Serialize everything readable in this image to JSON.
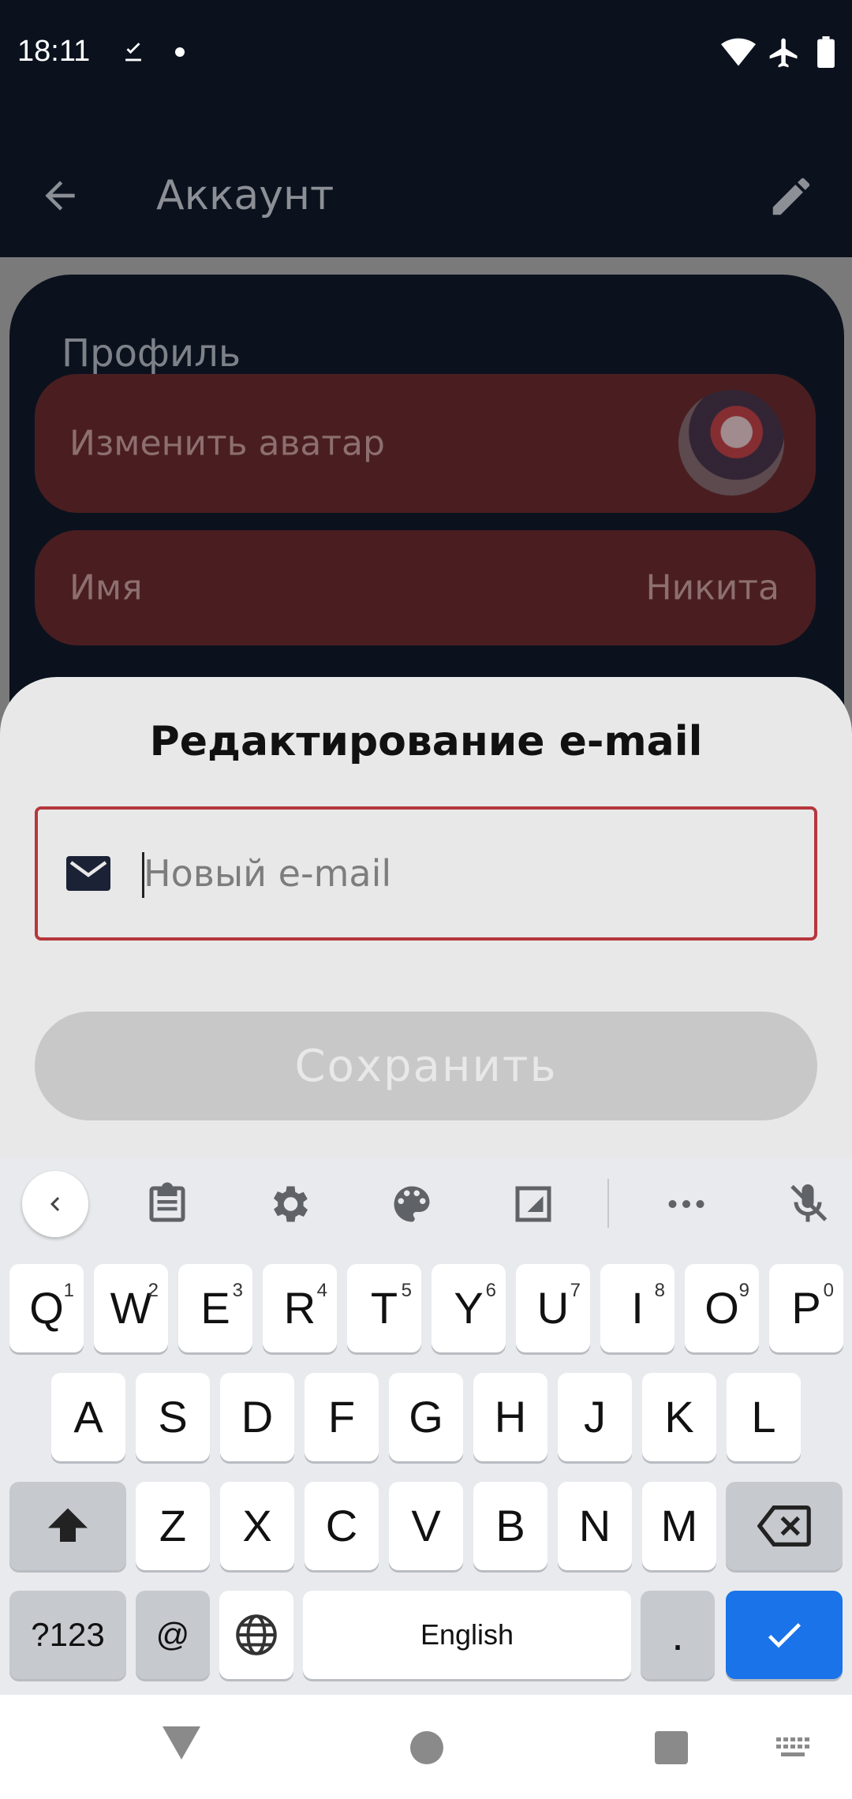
{
  "status_bar": {
    "time": "18:11"
  },
  "app_bar": {
    "title": "Аккаунт"
  },
  "profile": {
    "section_title": "Профиль",
    "change_avatar_label": "Изменить аватар",
    "name_label": "Имя",
    "name_value": "Никита"
  },
  "sheet": {
    "title": "Редактирование e-mail",
    "email_placeholder": "Новый e-mail",
    "email_value": "",
    "save_label": "Сохранить"
  },
  "keyboard": {
    "row1": [
      {
        "k": "Q",
        "h": "1"
      },
      {
        "k": "W",
        "h": "2"
      },
      {
        "k": "E",
        "h": "3"
      },
      {
        "k": "R",
        "h": "4"
      },
      {
        "k": "T",
        "h": "5"
      },
      {
        "k": "Y",
        "h": "6"
      },
      {
        "k": "U",
        "h": "7"
      },
      {
        "k": "I",
        "h": "8"
      },
      {
        "k": "O",
        "h": "9"
      },
      {
        "k": "P",
        "h": "0"
      }
    ],
    "row2": [
      "A",
      "S",
      "D",
      "F",
      "G",
      "H",
      "J",
      "K",
      "L"
    ],
    "row3": [
      "Z",
      "X",
      "C",
      "V",
      "B",
      "N",
      "M"
    ],
    "symbols_label": "?123",
    "at_label": "@",
    "space_label": "English",
    "period_label": "."
  },
  "colors": {
    "accent_border": "#b5373c",
    "enter_key": "#1a73e8",
    "app_bg": "#0b121e"
  }
}
